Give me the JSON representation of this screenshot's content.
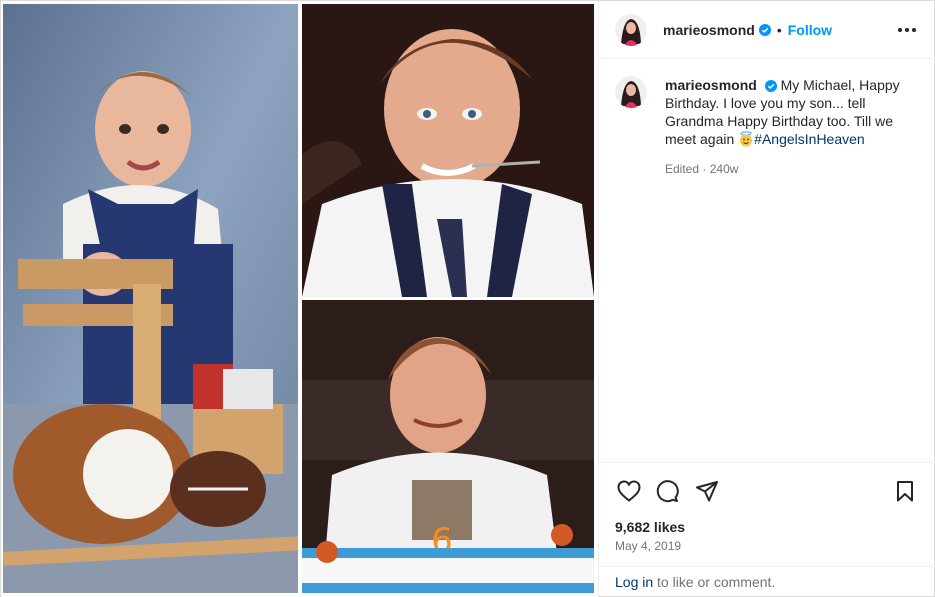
{
  "post": {
    "username": "marieosmond",
    "follow_label": "Follow",
    "separator": "•",
    "caption": {
      "text": "My Michael, Happy Birthday. I love you my son... tell Grandma Happy Birthday too. Till we meet again",
      "hashtag": "#AngelsInHeaven"
    },
    "edited_label": "Edited",
    "meta_separator": "·",
    "age": "240w",
    "likes": "9,682 likes",
    "date": "May 4, 2019",
    "login_link": "Log in",
    "login_rest": " to like or comment."
  },
  "icons": {
    "more": "more-options-icon",
    "like": "heart-icon",
    "comment": "comment-icon",
    "share": "paper-plane-icon",
    "save": "bookmark-icon",
    "verified": "verified-badge-icon"
  },
  "colors": {
    "accent": "#0095f6",
    "hashtag": "#00376b",
    "secondary_text": "#737373",
    "verified": "#0095f6"
  }
}
